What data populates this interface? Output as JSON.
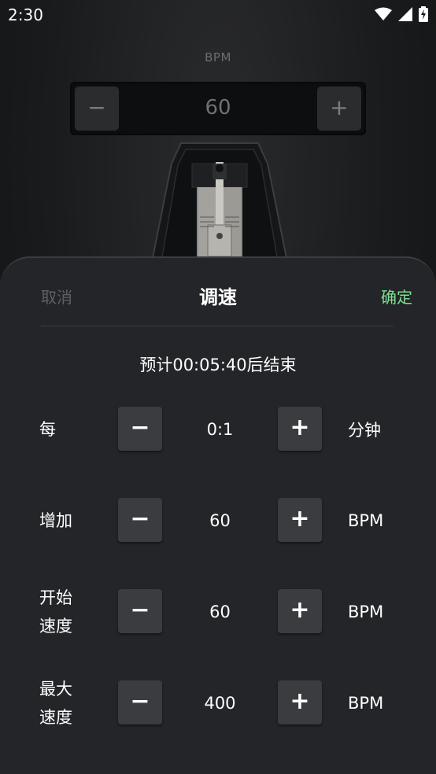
{
  "status_bar": {
    "time": "2:30"
  },
  "bpm": {
    "label": "BPM",
    "value": "60",
    "minus": "−",
    "plus": "+"
  },
  "sheet": {
    "cancel": "取消",
    "title": "调速",
    "confirm": "确定",
    "estimate": "预计00:05:40后结束",
    "rows": [
      {
        "label": "每",
        "value": "0:1",
        "unit": "分钟"
      },
      {
        "label": "增加",
        "value": "60",
        "unit": "BPM"
      },
      {
        "label_line1": "开始",
        "label_line2": "速度",
        "value": "60",
        "unit": "BPM"
      },
      {
        "label_line1": "最大",
        "label_line2": "速度",
        "value": "400",
        "unit": "BPM"
      }
    ],
    "minus": "−",
    "plus": "+"
  },
  "colors": {
    "accent": "#7fe08f",
    "sheet_bg": "#232528",
    "button_bg": "#3a3c40"
  },
  "icons": [
    "wifi-icon",
    "signal-icon",
    "battery-charging-icon"
  ]
}
